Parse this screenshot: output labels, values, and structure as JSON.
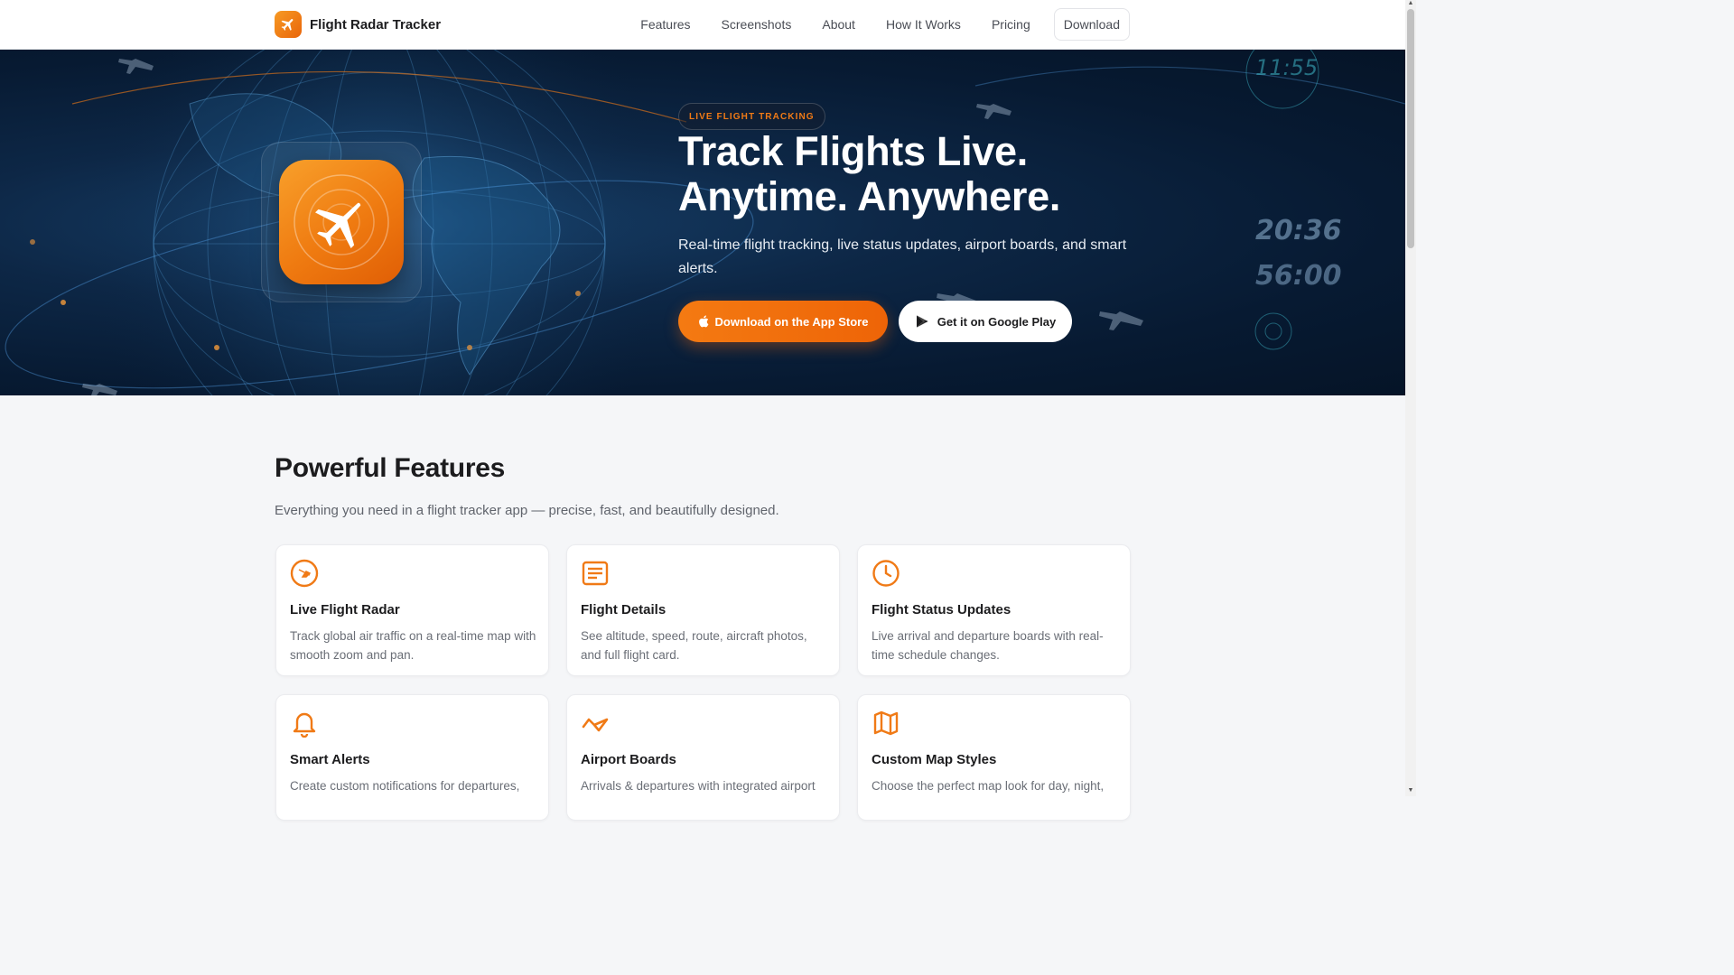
{
  "header": {
    "brand_name": "Flight Radar Tracker",
    "nav": [
      "Features",
      "Screenshots",
      "About",
      "How It Works",
      "Pricing",
      "Download"
    ]
  },
  "hero": {
    "badge": "LIVE FLIGHT TRACKING",
    "title_line1": "Track Flights Live.",
    "title_line2": "Anytime. Anywhere.",
    "subtitle": "Real-time flight tracking, live status updates, airport boards, and smart alerts.",
    "primary_button": "Download on the App Store",
    "secondary_button": "Get it on Google Play",
    "bg_text_time1": "11:55",
    "bg_text_time2": "20:36",
    "bg_text_time3": "56:00"
  },
  "features": {
    "title": "Powerful Features",
    "subtitle": "Everything you need in a flight tracker app — precise, fast, and beautifully designed.",
    "cards": [
      {
        "title": "Live Flight Radar",
        "desc": "Track global air traffic on a real-time map with smooth zoom and pan.",
        "icon": "radar-icon"
      },
      {
        "title": "Flight Details",
        "desc": "See altitude, speed, route, aircraft photos, and full flight card.",
        "icon": "document-icon"
      },
      {
        "title": "Flight Status Updates",
        "desc": "Live arrival and departure boards with real-time schedule changes.",
        "icon": "clock-icon"
      },
      {
        "title": "Smart Alerts",
        "desc": "Create custom notifications for departures,",
        "icon": "bell-icon"
      },
      {
        "title": "Airport Boards",
        "desc": "Arrivals & departures with integrated airport",
        "icon": "plane-icon"
      },
      {
        "title": "Custom Map Styles",
        "desc": "Choose the perfect map look for day, night,",
        "icon": "map-icon"
      }
    ]
  },
  "colors": {
    "accent": "#f07a16",
    "hero_bg": "#0b2340",
    "text": "#1c1c1e"
  }
}
